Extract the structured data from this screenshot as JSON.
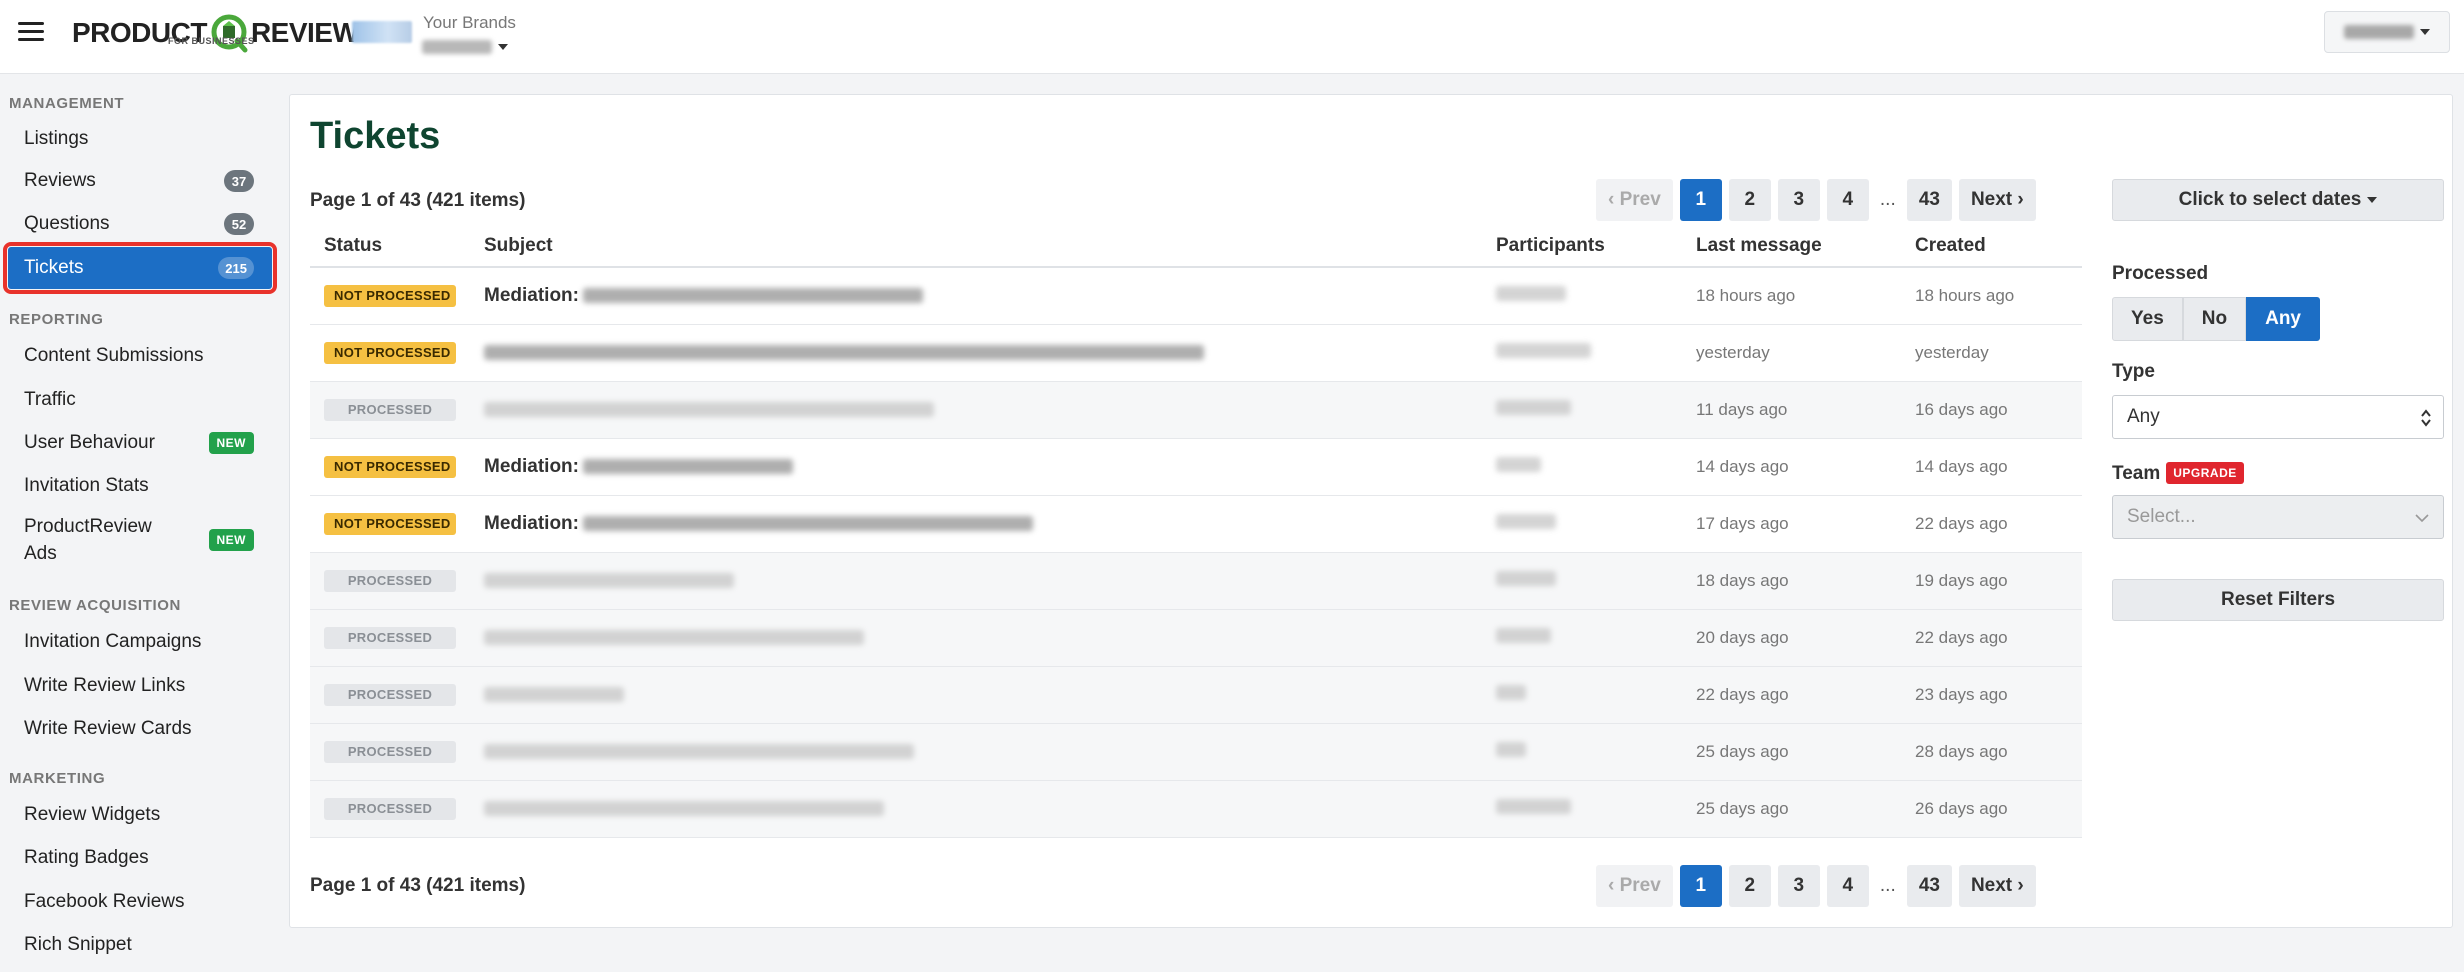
{
  "header": {
    "logo_left": "PRODUCT",
    "logo_right": "REVIEW",
    "logo_sub": "FOR BUSINESSES",
    "brands_label": "Your Brands"
  },
  "sidebar": {
    "sections": [
      {
        "heading": "MANAGEMENT",
        "items": [
          {
            "label": "Listings"
          },
          {
            "label": "Reviews",
            "count": "37"
          },
          {
            "label": "Questions",
            "count": "52"
          },
          {
            "label": "Tickets",
            "count": "215",
            "active": true
          }
        ]
      },
      {
        "heading": "REPORTING",
        "items": [
          {
            "label": "Content Submissions"
          },
          {
            "label": "Traffic"
          },
          {
            "label": "User Behaviour",
            "tag": "NEW"
          },
          {
            "label": "Invitation Stats"
          },
          {
            "label": "ProductReview Ads",
            "tag": "NEW"
          }
        ]
      },
      {
        "heading": "REVIEW ACQUISITION",
        "items": [
          {
            "label": "Invitation Campaigns"
          },
          {
            "label": "Write Review Links"
          },
          {
            "label": "Write Review Cards"
          }
        ]
      },
      {
        "heading": "MARKETING",
        "items": [
          {
            "label": "Review Widgets"
          },
          {
            "label": "Rating Badges"
          },
          {
            "label": "Facebook Reviews"
          },
          {
            "label": "Rich Snippet"
          }
        ]
      }
    ]
  },
  "main": {
    "title": "Tickets",
    "page_info": "Page 1 of 43 (421 items)",
    "pagination": {
      "prev": "‹ Prev",
      "pages": [
        "1",
        "2",
        "3",
        "4"
      ],
      "ellipsis": "...",
      "last": "43",
      "next": "Next ›"
    },
    "columns": [
      "Status",
      "Subject",
      "Participants",
      "Last message",
      "Created"
    ],
    "rows": [
      {
        "status": "NOT PROCESSED",
        "subject_prefix": "Mediation:",
        "last": "18 hours ago",
        "created": "18 hours ago"
      },
      {
        "status": "NOT PROCESSED",
        "subject_prefix": "",
        "last": "yesterday",
        "created": "yesterday"
      },
      {
        "status": "PROCESSED",
        "subject_prefix": "",
        "last": "11 days ago",
        "created": "16 days ago"
      },
      {
        "status": "NOT PROCESSED",
        "subject_prefix": "Mediation:",
        "last": "14 days ago",
        "created": "14 days ago"
      },
      {
        "status": "NOT PROCESSED",
        "subject_prefix": "Mediation:",
        "last": "17 days ago",
        "created": "22 days ago"
      },
      {
        "status": "PROCESSED",
        "subject_prefix": "",
        "last": "18 days ago",
        "created": "19 days ago"
      },
      {
        "status": "PROCESSED",
        "subject_prefix": "",
        "last": "20 days ago",
        "created": "22 days ago"
      },
      {
        "status": "PROCESSED",
        "subject_prefix": "",
        "last": "22 days ago",
        "created": "23 days ago"
      },
      {
        "status": "PROCESSED",
        "subject_prefix": "",
        "last": "25 days ago",
        "created": "28 days ago"
      },
      {
        "status": "PROCESSED",
        "subject_prefix": "",
        "last": "25 days ago",
        "created": "26 days ago"
      }
    ]
  },
  "filters": {
    "date_button": "Click to select dates",
    "processed_label": "Processed",
    "processed_options": [
      "Yes",
      "No",
      "Any"
    ],
    "processed_selected": "Any",
    "type_label": "Type",
    "type_value": "Any",
    "team_label": "Team",
    "team_badge": "UPGRADE",
    "team_placeholder": "Select...",
    "reset_label": "Reset Filters"
  },
  "colors": {
    "accent": "#1c6ec5",
    "title_green": "#0f4530",
    "not_processed": "#f5c042",
    "new_badge": "#22a14b",
    "upgrade_badge": "#e0262e",
    "highlight_outline": "#e8322b"
  }
}
